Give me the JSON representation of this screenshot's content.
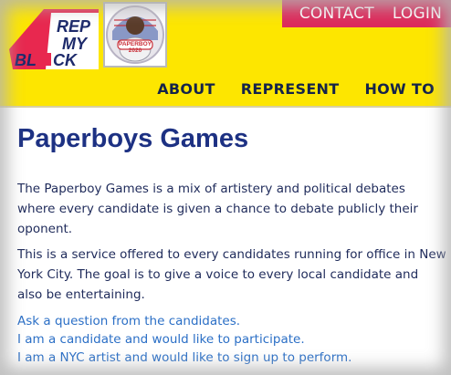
{
  "header": {
    "logo": {
      "text": "REP MY BLOCK",
      "colors": {
        "red": "#e8284f",
        "navy": "#1d2a6b",
        "yellow": "#fde600"
      }
    },
    "avatar": {
      "badge": "PAPERBOY 2020",
      "icon": "astronaut-avatar"
    },
    "top_links": [
      {
        "label": "CONTACT"
      },
      {
        "label": "LOGIN"
      }
    ],
    "nav": [
      {
        "label": "ABOUT"
      },
      {
        "label": "REPRESENT"
      },
      {
        "label": "HOW TO"
      }
    ]
  },
  "main": {
    "title": "Paperboys Games",
    "paragraphs": [
      "The Paperboy Games is a mix of artistery and political debates where every candidate is given a chance to debate publicly their oponent.",
      "This is a service offered to every candidates running for office in New York City. The goal is to give a voice to every local candidate and also be entertaining."
    ],
    "links": [
      {
        "label": "Ask a question from the candidates."
      },
      {
        "label": "I am a candidate and would like to participate."
      },
      {
        "label": "I am a NYC artist and would like to sign up to perform."
      }
    ]
  },
  "colors": {
    "header_bg": "#fde600",
    "topbar_bg": "#dd2a5b",
    "title": "#1d3183",
    "link": "#2b6fc6"
  }
}
